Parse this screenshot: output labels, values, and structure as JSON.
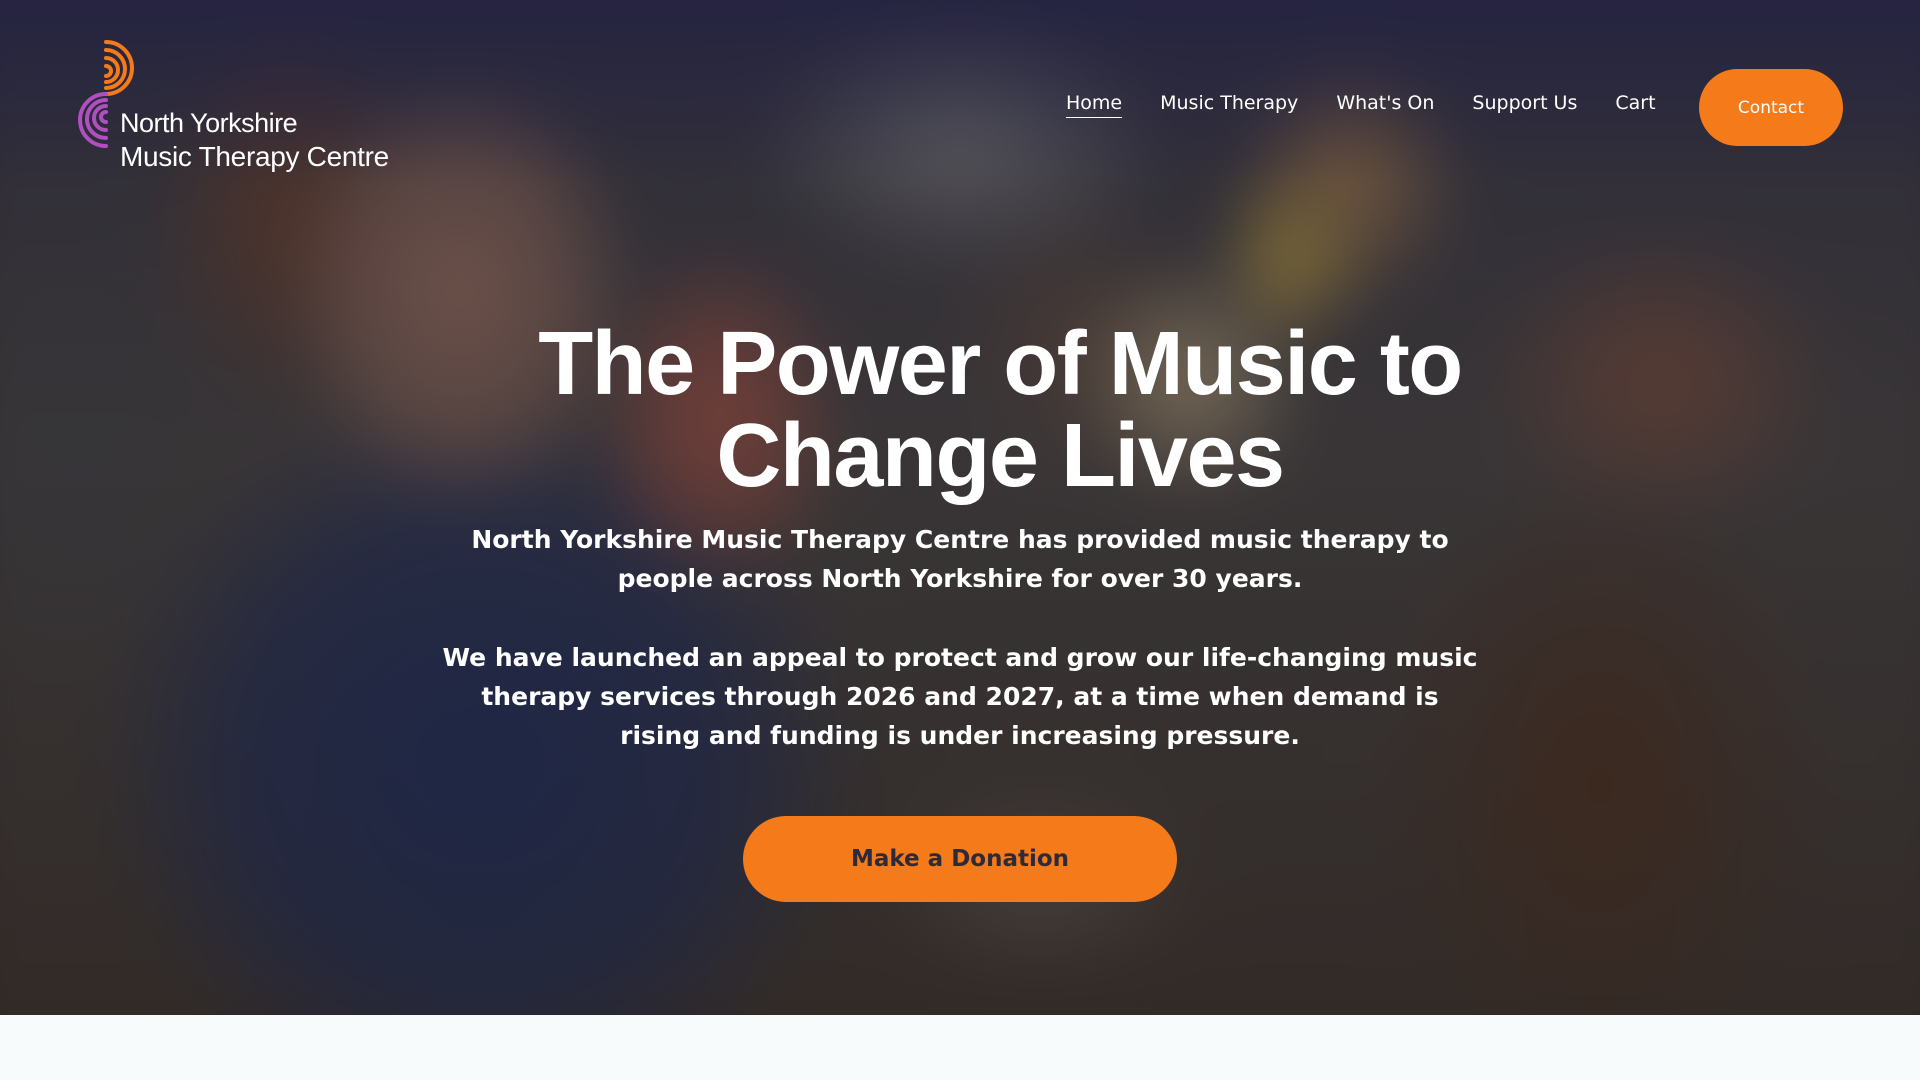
{
  "brand": {
    "name_line1": "North Yorkshire",
    "name_line2": "Music Therapy Centre",
    "icon": "sound-wave-logo-icon",
    "colors": {
      "orange": "#f57a1a",
      "purple": "#b04fc0"
    }
  },
  "nav": {
    "items": [
      {
        "label": "Home",
        "active": true
      },
      {
        "label": "Music Therapy",
        "active": false
      },
      {
        "label": "What's On",
        "active": false
      },
      {
        "label": "Support Us",
        "active": false
      },
      {
        "label": "Cart",
        "active": false
      }
    ],
    "contact_label": "Contact"
  },
  "hero": {
    "title_line1": "The Power of Music to",
    "title_line2": "Change Lives",
    "paragraph1": "North Yorkshire Music Therapy Centre has provided music therapy to people across North Yorkshire for over 30 years.",
    "paragraph2": "We have launched an appeal to protect and grow our life-changing music therapy services through 2026 and 2027, at a time when demand is rising and funding is under increasing pressure.",
    "cta_label": "Make a Donation"
  },
  "theme": {
    "accent": "#f57a1a",
    "cta_text": "#2d2a3a",
    "text_on_hero": "#ffffff"
  }
}
